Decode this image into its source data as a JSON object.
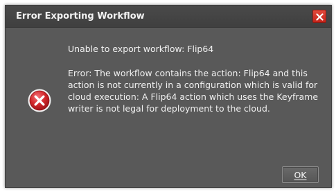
{
  "dialog": {
    "title": "Error Exporting Workflow",
    "headline": "Unable to export workflow: Flip64",
    "detail": "Error: The workflow contains the action: Flip64 and this action is not currently in a configuration which is valid for cloud execution: A Flip64 action which uses the Keyframe writer is not legal for deployment to the cloud.",
    "ok_label": "OK",
    "icons": {
      "close": "close-icon",
      "status": "error-icon"
    },
    "colors": {
      "background": "#595959",
      "titlebar": "#444444",
      "close_button": "#d33a2e",
      "error_icon": "#d2282b",
      "text": "#f0f0f0"
    }
  }
}
